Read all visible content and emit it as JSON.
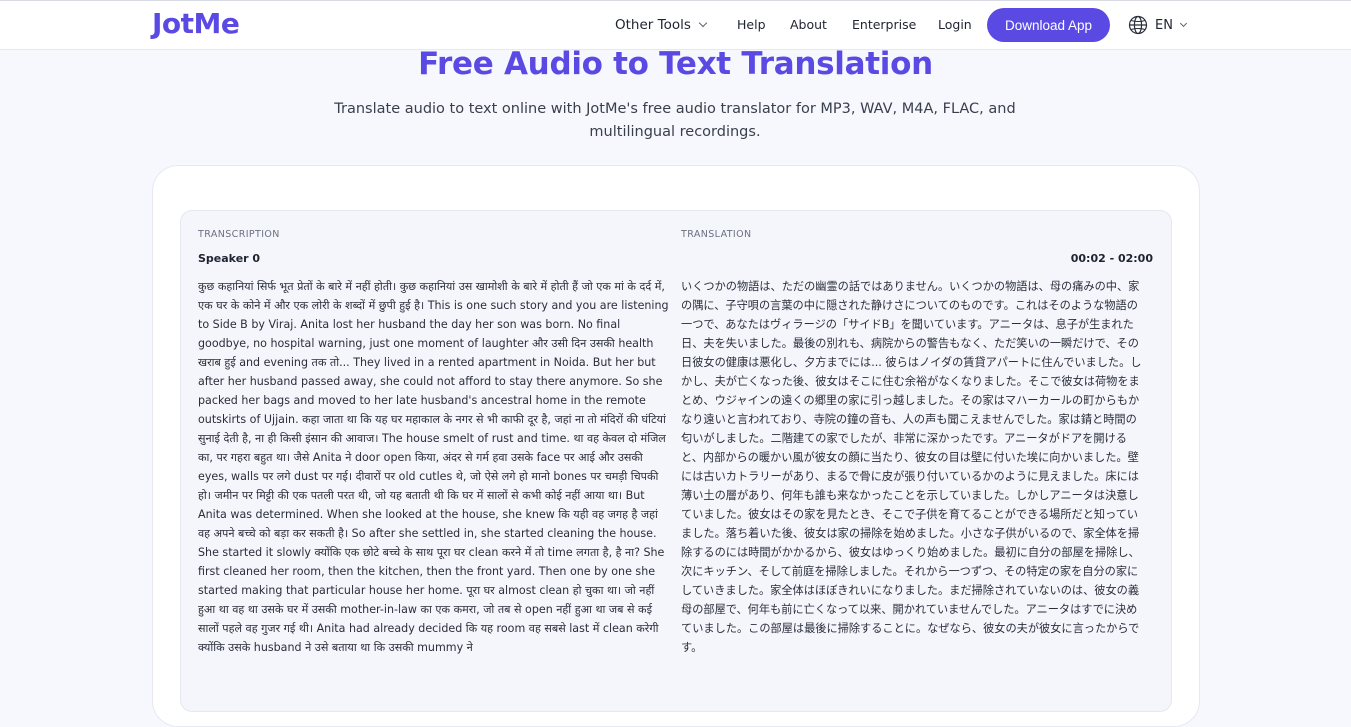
{
  "header": {
    "logo": "JotMe",
    "nav": {
      "other_tools": "Other Tools",
      "help": "Help",
      "about": "About",
      "enterprise": "Enterprise",
      "login": "Login"
    },
    "download_button": "Download App",
    "language": "EN",
    "icons": {
      "other_tools_chevron": "chevron-down-icon",
      "language_globe": "globe-icon",
      "language_chevron": "chevron-down-icon"
    }
  },
  "hero": {
    "title": "Free Audio to Text Translation",
    "subtitle": "Translate audio to text online with JotMe's free audio translator for MP3, WAV, M4A, FLAC, and multilingual recordings."
  },
  "result": {
    "transcription_label": "TRANSCRIPTION",
    "translation_label": "TRANSLATION",
    "speaker": "Speaker 0",
    "time_range": "00:02 - 02:00",
    "transcription_text": "कुछ कहानियां सिर्फ भूत प्रेतों के बारे में नहीं होती। कुछ कहानियां उस खामोशी के बारे में होती हैं जो एक मां के दर्द में, एक घर के कोने में और एक लोरी के शब्दों में छुपी हुई है। This is one such story and you are listening to Side B by Viraj. Anita lost her husband the day her son was born. No final goodbye, no hospital warning, just one moment of laughter और उसी दिन उसकी health खराब हुई and evening तक तो... They lived in a rented apartment in Noida. But her but after her husband passed away, she could not afford to stay there anymore. So she packed her bags and moved to her late husband's ancestral home in the remote outskirts of Ujjain. कहा जाता था कि यह घर महाकाल के नगर से भी काफी दूर है, जहां ना तो मंदिरों की घंटियां सुनाई देती है, ना ही किसी इंसान की आवाज। The house smelt of rust and time. था वह केवल दो मंजिल का, पर गहरा बहुत था। जैसे Anita ने door open किया, अंदर से गर्म हवा उसके face पर आई और उसकी eyes, walls पर लगे dust पर गई। दीवारों पर old cutles थे, जो ऐसे लगे हो मानो bones पर चमड़ी चिपकी हो। जमीन पर मिट्टी की एक पतली परत थी, जो यह बताती थी कि घर में सालों से कभी कोई नहीं आया था। But Anita was determined. When she looked at the house, she knew कि यही वह जगह है जहां वह अपने बच्चे को बड़ा कर सकती है। So after she settled in, she started cleaning the house. She started it slowly क्योंकि एक छोटे बच्चे के साथ पूरा घर clean करने में तो time लगता है, है ना? She first cleaned her room, then the kitchen, then the front yard. Then one by one she started making that particular house her home. पूरा घर almost clean हो चुका था। जो नहीं हुआ था वह था उसके घर में उसकी mother-in-law का एक कमरा, जो तब से open नहीं हुआ था जब से कई सालों पहले वह गुजर गई थी। Anita had already decided कि यह room वह सबसे last में clean करेगी क्योंकि उसके husband ने उसे बताया था कि उसकी mummy ने",
    "translation_text": "いくつかの物語は、ただの幽霊の話ではありません。いくつかの物語は、母の痛みの中、家の隅に、子守唄の言葉の中に隠された静けさについてのものです。これはそのような物語の一つで、あなたはヴィラージの「サイドB」を聞いています。アニータは、息子が生まれた日、夫を失いました。最後の別れも、病院からの警告もなく、ただ笑いの一瞬だけで、その日彼女の健康は悪化し、夕方までには... 彼らはノイダの賃貸アパートに住んでいました。しかし、夫が亡くなった後、彼女はそこに住む余裕がなくなりました。そこで彼女は荷物をまとめ、ウジャインの遠くの郷里の家に引っ越しました。その家はマハーカールの町からもかなり遠いと言われており、寺院の鐘の音も、人の声も聞こえませんでした。家は錆と時間の匂いがしました。二階建ての家でしたが、非常に深かったです。アニータがドアを開けると、内部からの暖かい風が彼女の顔に当たり、彼女の目は壁に付いた埃に向かいました。壁には古いカトラリーがあり、まるで骨に皮が張り付いているかのように見えました。床には薄い土の層があり、何年も誰も来なかったことを示していました。しかしアニータは決意していました。彼女はその家を見たとき、そこで子供を育てることができる場所だと知っていました。落ち着いた後、彼女は家の掃除を始めました。小さな子供がいるので、家全体を掃除するのには時間がかかるから、彼女はゆっくり始めました。最初に自分の部屋を掃除し、次にキッチン、そして前庭を掃除しました。それから一つずつ、その特定の家を自分の家にしていきました。家全体はほぼきれいになりました。まだ掃除されていないのは、彼女の義母の部屋で、何年も前に亡くなって以来、開かれていませんでした。アニータはすでに決めていました。この部屋は最後に掃除することに。なぜなら、彼女の夫が彼女に言ったからです。"
  },
  "colors": {
    "brand": "#5a4ae3",
    "text": "#1f2330",
    "panel": "#f4f6fc"
  }
}
